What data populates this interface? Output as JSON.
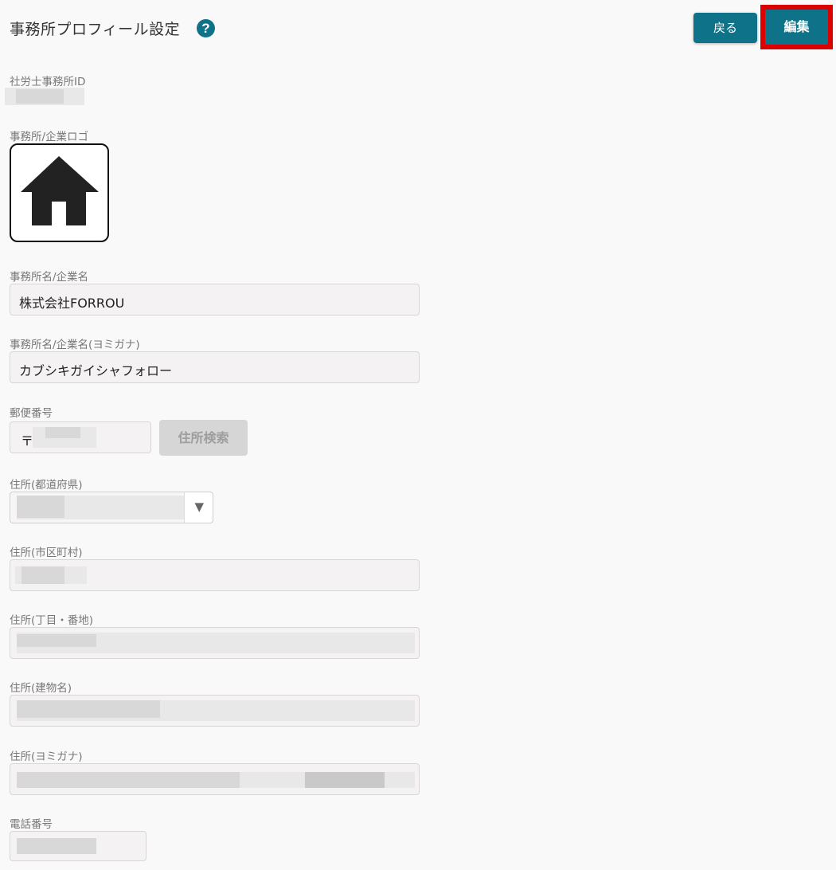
{
  "header": {
    "title": "事務所プロフィール設定",
    "help_glyph": "?",
    "back_label": "戻る",
    "edit_label": "編集"
  },
  "office_id": {
    "label": "社労士事務所ID"
  },
  "logo": {
    "label": "事務所/企業ロゴ",
    "icon": "home-icon"
  },
  "office_name": {
    "label": "事務所名/企業名",
    "value": "株式会社FORROU"
  },
  "office_kana": {
    "label": "事務所名/企業名(ヨミガナ)",
    "value": "カブシキガイシャフォロー"
  },
  "postal": {
    "label": "郵便番号",
    "prefix": "〒",
    "search_label": "住所検索"
  },
  "prefecture": {
    "label": "住所(都道府県)",
    "arrow": "▼"
  },
  "city": {
    "label": "住所(市区町村)"
  },
  "street": {
    "label": "住所(丁目・番地)"
  },
  "building": {
    "label": "住所(建物名)"
  },
  "address_kana": {
    "label": "住所(ヨミガナ)"
  },
  "phone": {
    "label": "電話番号"
  },
  "colors": {
    "accent": "#0e7388",
    "highlight": "#dd0000"
  }
}
